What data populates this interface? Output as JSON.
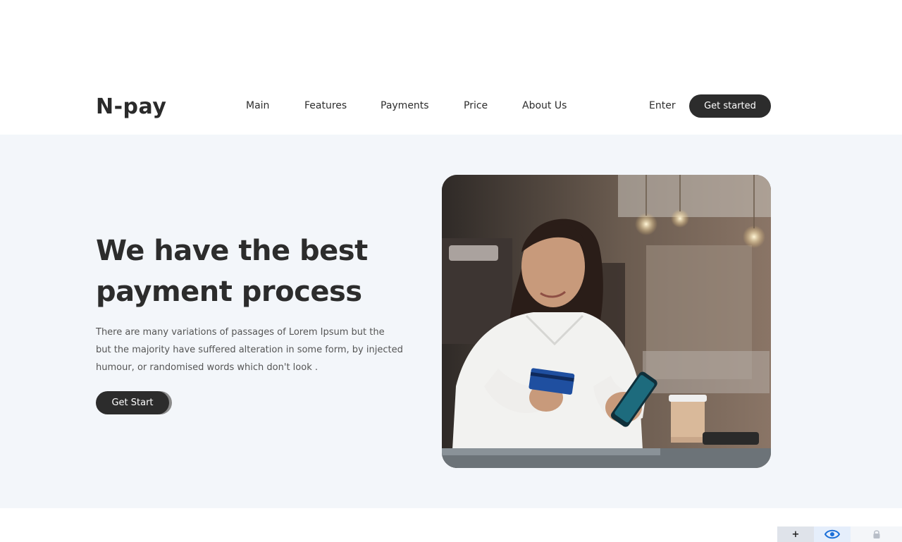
{
  "header": {
    "logo": "N-pay",
    "nav": [
      "Main",
      "Features",
      "Payments",
      "Price",
      "About Us"
    ],
    "enter_label": "Enter",
    "cta_label": "Get started"
  },
  "hero": {
    "title_line1": "We have the best",
    "title_line2": "payment process",
    "description_line1": "There are many variations of passages of Lorem Ipsum but the",
    "description_line2": "but the majority have suffered alteration in some form, by injected",
    "description_line3": "humour, or randomised words which don't look .",
    "button_label": "Get Start"
  },
  "toolbar": {
    "icons": [
      "plus-icon",
      "eye-icon",
      "lock-icon"
    ],
    "plus_glyph": "+"
  },
  "colors": {
    "dark_button": "#2c2c2c",
    "hero_background": "#f3f6fa",
    "eye_icon": "#1b6fd8"
  }
}
